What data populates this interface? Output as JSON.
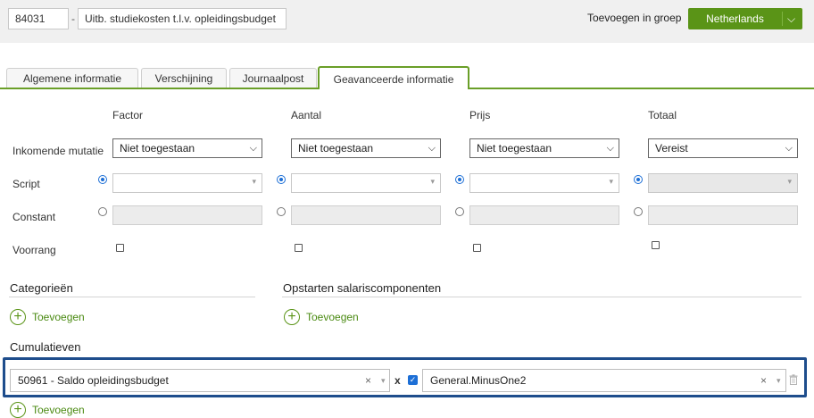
{
  "header": {
    "code": "84031",
    "dash": "-",
    "description": "Uitb. studiekosten t.l.v. opleidingsbudget",
    "group_label": "Toevoegen in groep",
    "group_button": "Netherlands"
  },
  "tabs": [
    {
      "label": "Algemene informatie",
      "active": false
    },
    {
      "label": "Verschijning",
      "active": false
    },
    {
      "label": "Journaalpost",
      "active": false
    },
    {
      "label": "Geavanceerde informatie",
      "active": true
    }
  ],
  "grid": {
    "columns": [
      "Factor",
      "Aantal",
      "Prijs",
      "Totaal"
    ],
    "rows": {
      "incoming": "Inkomende mutatie",
      "script": "Script",
      "constant": "Constant",
      "priority": "Voorrang"
    },
    "incoming_values": [
      "Niet toegestaan",
      "Niet toegestaan",
      "Niet toegestaan",
      "Vereist"
    ]
  },
  "sections": {
    "categories": "Categorieën",
    "startup": "Opstarten salariscomponenten",
    "cumulatives": "Cumulatieven",
    "add_label": "Toevoegen"
  },
  "cumulative": {
    "left_value": "50961 - Saldo opleidingsbudget",
    "multiplier": "x",
    "right_value": "General.MinusOne2"
  },
  "glyphs": {
    "chevron": "⌵",
    "caret": "▾",
    "clear": "×",
    "plus": "+",
    "check": "✓"
  },
  "colors": {
    "accent_green": "#5a9417",
    "tab_green": "#6a9f28",
    "highlight_blue": "#1e4d8c",
    "radio_blue": "#1d6fd6"
  }
}
